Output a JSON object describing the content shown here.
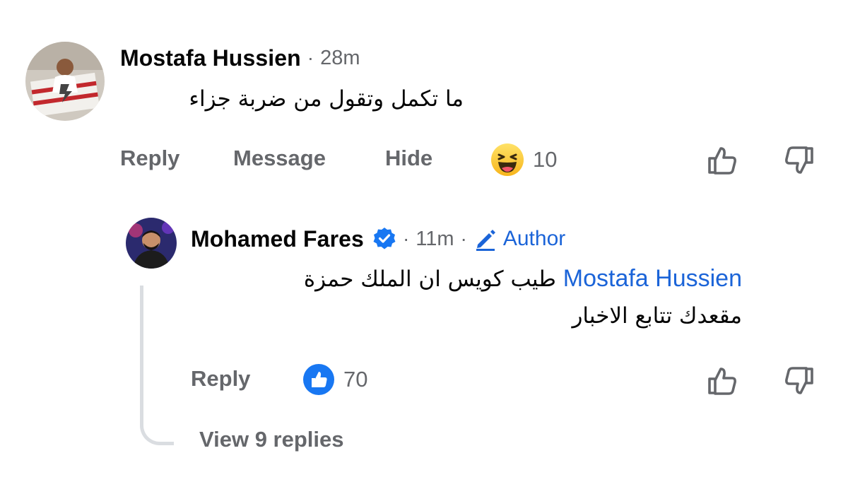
{
  "comment": {
    "author": "Mostafa Hussien",
    "separator": "·",
    "time": "28m",
    "text": "ما تكمل وتقول من ضربة جزاء",
    "actions": {
      "reply": "Reply",
      "message": "Message",
      "hide": "Hide"
    },
    "reaction": {
      "icon": "haha-emoji-icon",
      "count": "10"
    }
  },
  "reply": {
    "author": "Mohamed Fares",
    "separator": "·",
    "time": "11m",
    "badge": "Author",
    "mention": "Mostafa Hussien",
    "text_line1": " طيب كويس ان الملك حمزة",
    "text_line2": "مقعدك تتابع الاخبار",
    "actions": {
      "reply": "Reply"
    },
    "reaction": {
      "icon": "like-reaction-icon",
      "count": "70"
    },
    "view_replies": "View 9 replies"
  },
  "colors": {
    "link": "#1b64d8",
    "secondary_text": "#65676b",
    "like_blue": "#1877f2",
    "thread_line": "#dadde1"
  }
}
